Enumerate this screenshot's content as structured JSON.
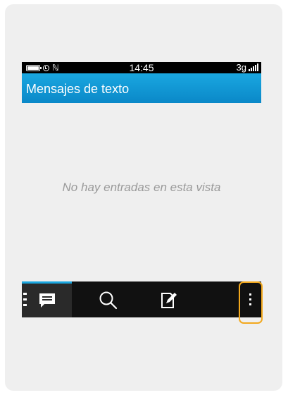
{
  "status_bar": {
    "time": "14:45",
    "network": "3g",
    "icons": [
      "battery-icon",
      "alarm-icon",
      "nfc-icon",
      "signal-icon"
    ]
  },
  "header": {
    "title": "Mensajes de texto"
  },
  "main": {
    "empty_message": "No hay entradas en esta vista"
  },
  "action_bar": {
    "items": [
      {
        "name": "messages-tab",
        "icon": "message-icon",
        "active": true
      },
      {
        "name": "search-button",
        "icon": "search-icon"
      },
      {
        "name": "compose-button",
        "icon": "compose-icon"
      },
      {
        "name": "overflow-menu-button",
        "icon": "more-vertical-icon"
      }
    ]
  },
  "colors": {
    "title_bar": "#0a88c8",
    "accent": "#1aa7e0",
    "action_bar": "#111111",
    "highlight": "#f2a81d",
    "empty_text": "#9a9a9a"
  },
  "icon_glyphs": {
    "nfc": "ℕ"
  }
}
